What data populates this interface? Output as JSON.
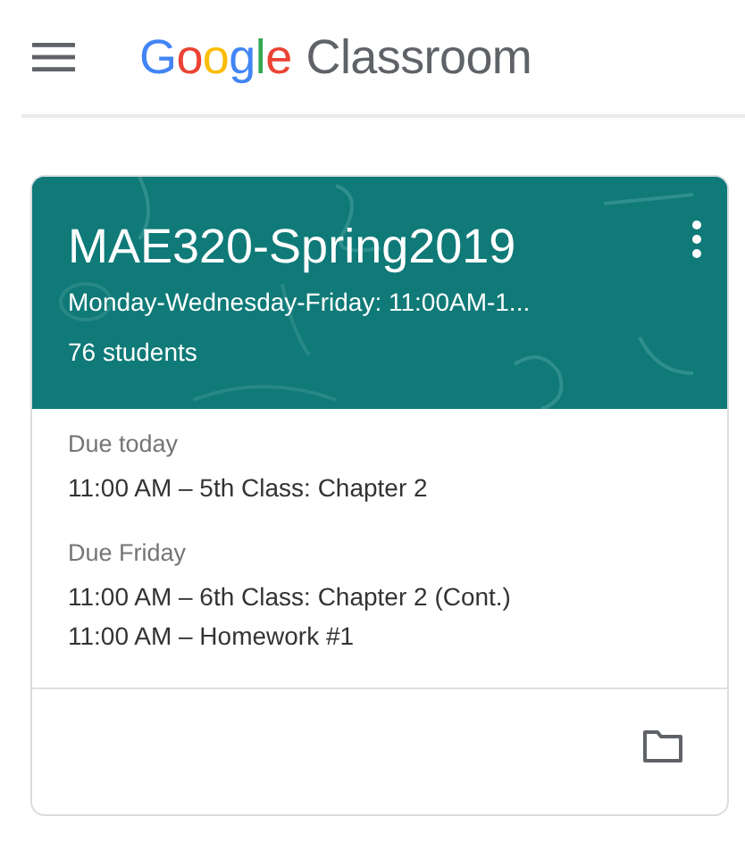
{
  "app_bar": {
    "brand": "Google",
    "product": "Classroom"
  },
  "class_card": {
    "title": "MAE320-Spring2019",
    "schedule": "Monday-Wednesday-Friday: 11:00AM-1...",
    "students": "76 students",
    "due_groups": [
      {
        "label": "Due today",
        "items": [
          "11:00 AM – 5th Class: Chapter 2"
        ]
      },
      {
        "label": "Due Friday",
        "items": [
          "11:00 AM – 6th Class: Chapter 2 (Cont.)",
          "11:00 AM – Homework #1"
        ]
      }
    ]
  }
}
